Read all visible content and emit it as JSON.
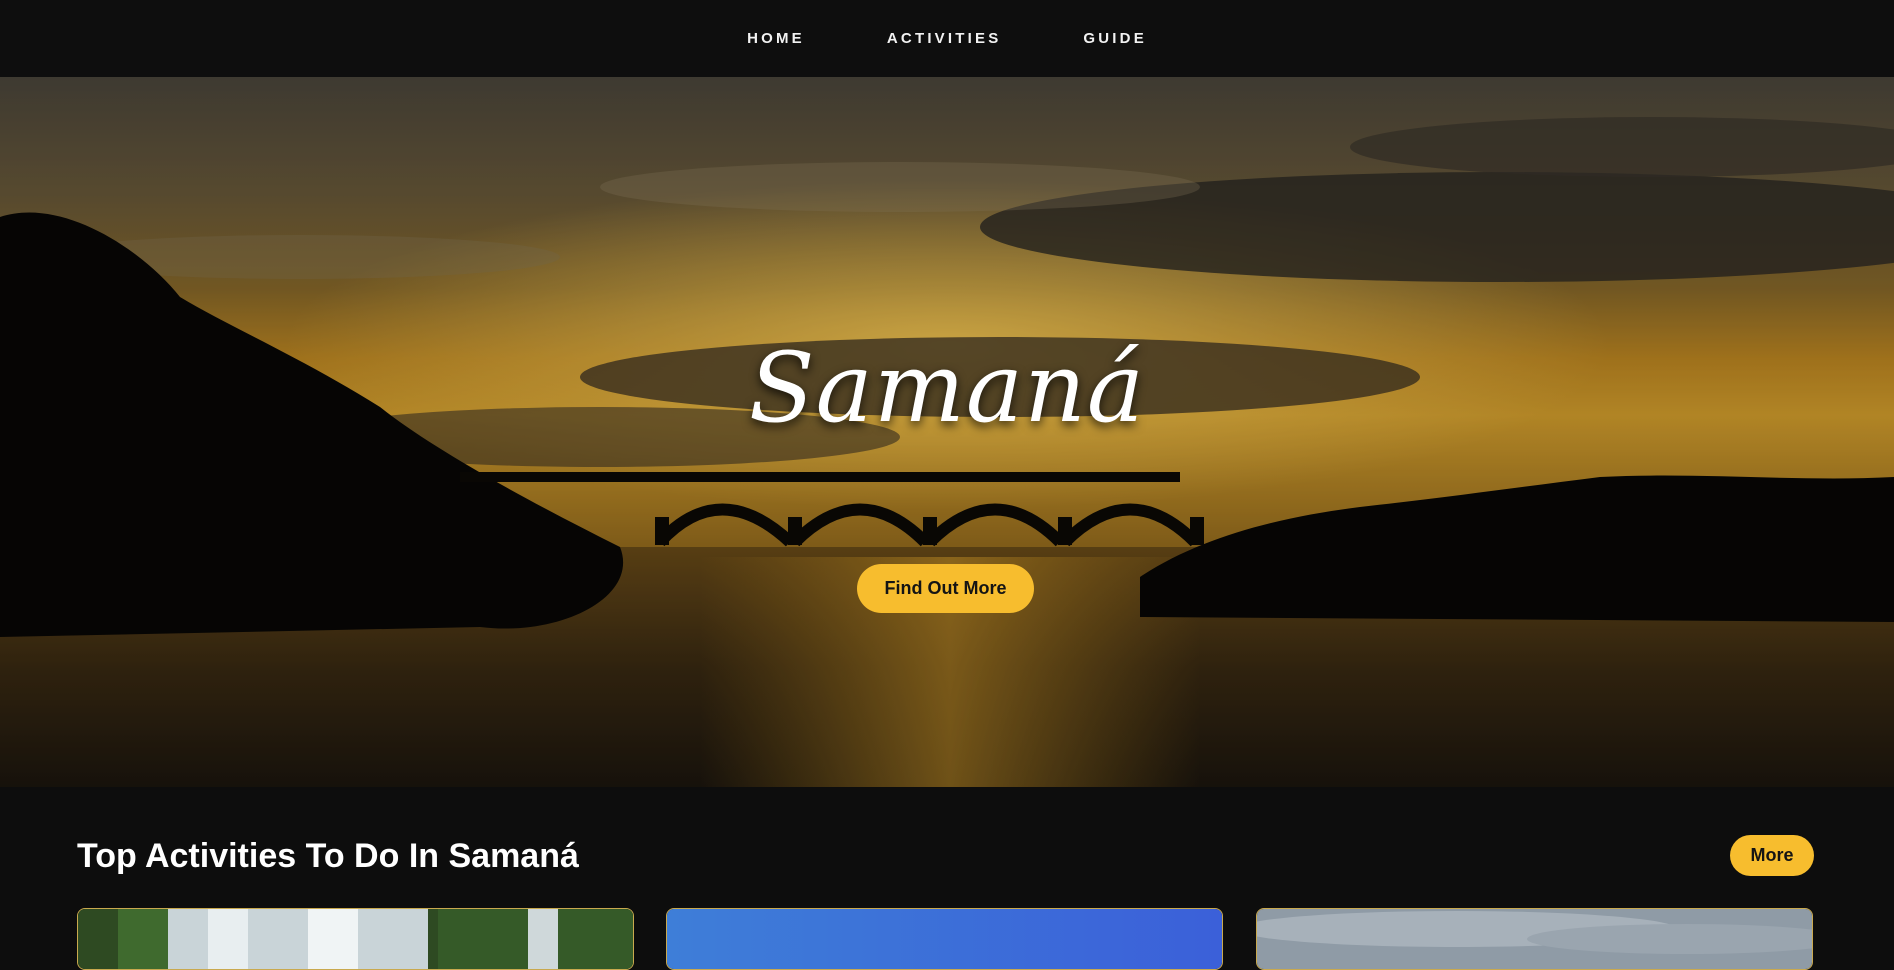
{
  "nav": {
    "items": [
      {
        "label": "HOME"
      },
      {
        "label": "ACTIVITIES"
      },
      {
        "label": "GUIDE"
      }
    ]
  },
  "hero": {
    "title": "Samaná",
    "cta_label": "Find Out More"
  },
  "activities": {
    "heading": "Top Activities To Do In Samaná",
    "more_label": "More"
  },
  "colors": {
    "accent": "#f7bd2e",
    "background": "#0d0d0d"
  }
}
